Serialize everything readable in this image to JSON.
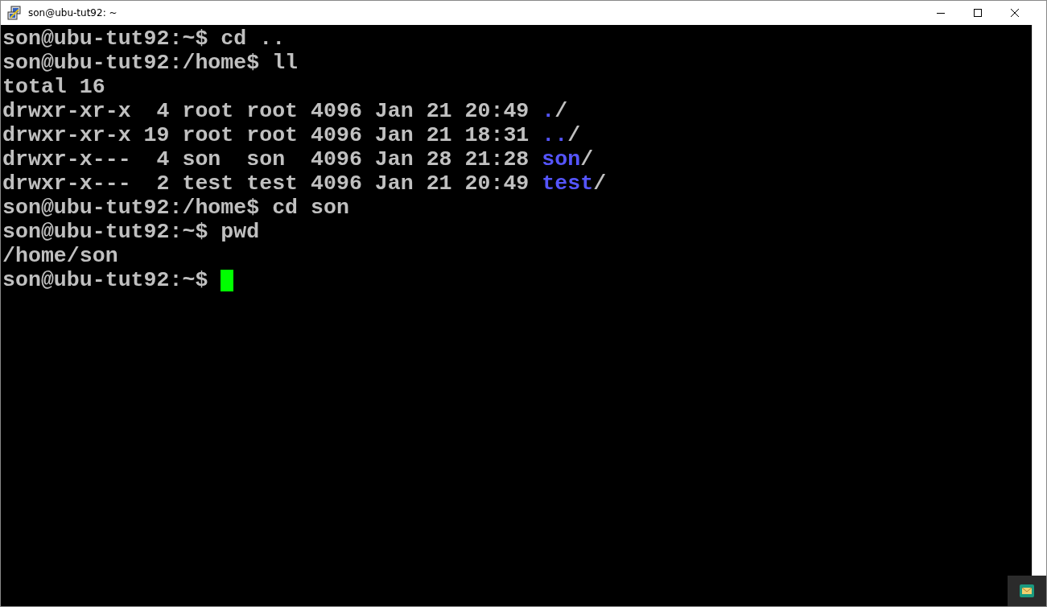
{
  "window": {
    "title": "son@ubu-tut92: ~"
  },
  "terminal": {
    "lines": [
      {
        "segments": [
          {
            "text": "son@ubu-tut92:~$ cd ..",
            "kind": "plain"
          }
        ]
      },
      {
        "segments": [
          {
            "text": "son@ubu-tut92:/home$ ll",
            "kind": "plain"
          }
        ]
      },
      {
        "segments": [
          {
            "text": "total 16",
            "kind": "plain"
          }
        ]
      },
      {
        "segments": [
          {
            "text": "drwxr-xr-x  4 root root 4096 Jan 21 20:49 ",
            "kind": "plain"
          },
          {
            "text": ".",
            "kind": "dir"
          },
          {
            "text": "/",
            "kind": "plain"
          }
        ]
      },
      {
        "segments": [
          {
            "text": "drwxr-xr-x 19 root root 4096 Jan 21 18:31 ",
            "kind": "plain"
          },
          {
            "text": "..",
            "kind": "dir"
          },
          {
            "text": "/",
            "kind": "plain"
          }
        ]
      },
      {
        "segments": [
          {
            "text": "drwxr-x---  4 son  son  4096 Jan 28 21:28 ",
            "kind": "plain"
          },
          {
            "text": "son",
            "kind": "dir"
          },
          {
            "text": "/",
            "kind": "plain"
          }
        ]
      },
      {
        "segments": [
          {
            "text": "drwxr-x---  2 test test 4096 Jan 21 20:49 ",
            "kind": "plain"
          },
          {
            "text": "test",
            "kind": "dir"
          },
          {
            "text": "/",
            "kind": "plain"
          }
        ]
      },
      {
        "segments": [
          {
            "text": "son@ubu-tut92:/home$ cd son",
            "kind": "plain"
          }
        ]
      },
      {
        "segments": [
          {
            "text": "son@ubu-tut92:~$ pwd",
            "kind": "plain"
          }
        ]
      },
      {
        "segments": [
          {
            "text": "/home/son",
            "kind": "plain"
          }
        ]
      },
      {
        "segments": [
          {
            "text": "son@ubu-tut92:~$ ",
            "kind": "plain"
          }
        ],
        "cursor": true
      }
    ]
  }
}
